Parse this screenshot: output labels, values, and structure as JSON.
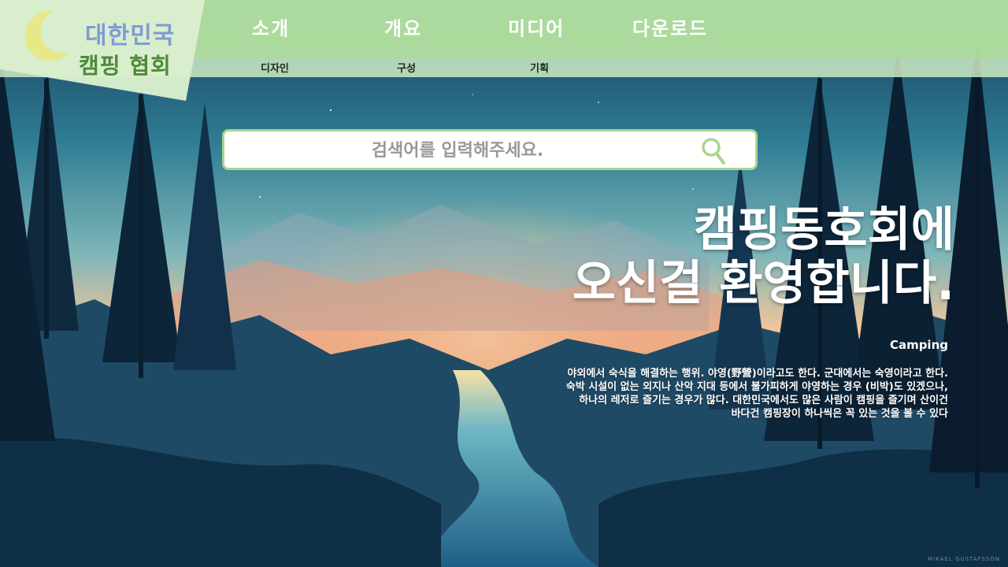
{
  "logo": {
    "line1": "대한민국",
    "line2": "캠핑 협회"
  },
  "nav": {
    "items": [
      {
        "label": "소개",
        "sub": "디자인"
      },
      {
        "label": "개요",
        "sub": "구성"
      },
      {
        "label": "미디어",
        "sub": "기획"
      },
      {
        "label": "다운로드",
        "sub": ""
      }
    ]
  },
  "search": {
    "placeholder": "검색어를 입력해주세요."
  },
  "hero": {
    "line1": "캠핑동호회에",
    "line2": "오신걸 환영합니다.",
    "sub": "Camping"
  },
  "description": [
    "야외에서 숙식을 해결하는 행위. 야영(野營)이라고도 한다. 군대에서는 숙영이라고 한다.",
    "숙박 시설이 없는 외지나 산악 지대 등에서 불가피하게 야영하는 경우 (비박)도 있겠으나,",
    "하나의 레저로 즐기는 경우가 많다. 대한민국에서도 많은 사람이 캠핑을 즐기며 산이건",
    "바다건 캠핑장이 하나씩은 꼭 있는 것을 볼 수 있다"
  ],
  "credit": "MIKAEL GUSTAFSSON",
  "colors": {
    "nav_band": "#b4e1a0",
    "logo_blue": "#7f9ad6",
    "logo_green": "#4f8a38",
    "search_border": "#a8d58e",
    "moon": "#e6e98a"
  },
  "icons": {
    "moon": "crescent-moon-icon",
    "search": "search-icon"
  }
}
